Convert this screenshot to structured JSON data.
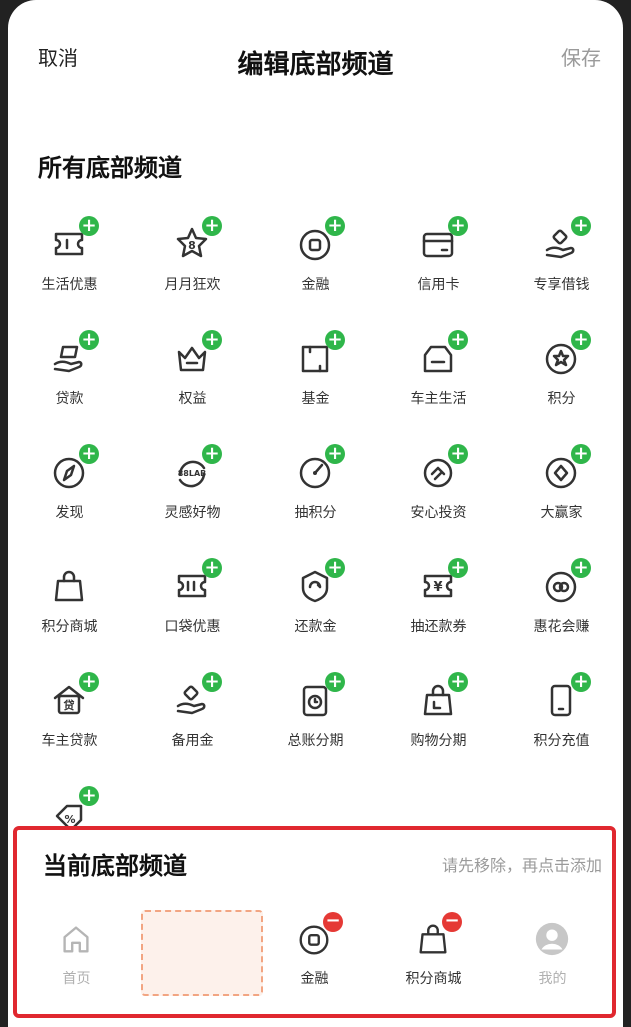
{
  "header": {
    "cancel": "取消",
    "title": "编辑底部频道",
    "save": "保存"
  },
  "all_section": {
    "title": "所有底部频道",
    "items": [
      {
        "label": "生活优惠",
        "icon": "ticket-icon"
      },
      {
        "label": "月月狂欢",
        "icon": "star-badge-icon"
      },
      {
        "label": "金融",
        "icon": "coin-icon"
      },
      {
        "label": "信用卡",
        "icon": "credit-card-icon"
      },
      {
        "label": "专享借钱",
        "icon": "hand-coin-icon"
      },
      {
        "label": "贷款",
        "icon": "hand-money-icon"
      },
      {
        "label": "权益",
        "icon": "crown-icon"
      },
      {
        "label": "基金",
        "icon": "fund-icon"
      },
      {
        "label": "车主生活",
        "icon": "car-icon"
      },
      {
        "label": "积分",
        "icon": "points-star-icon"
      },
      {
        "label": "发现",
        "icon": "compass-icon"
      },
      {
        "label": "灵感好物",
        "icon": "lab-icon"
      },
      {
        "label": "抽积分",
        "icon": "gauge-icon"
      },
      {
        "label": "安心投资",
        "icon": "shield-invest-icon"
      },
      {
        "label": "大赢家",
        "icon": "diamond-circle-icon"
      },
      {
        "label": "积分商城",
        "icon": "shopping-bag-icon"
      },
      {
        "label": "口袋优惠",
        "icon": "pocket-ticket-icon"
      },
      {
        "label": "还款金",
        "icon": "repay-shield-icon"
      },
      {
        "label": "抽还款券",
        "icon": "yuan-ticket-icon"
      },
      {
        "label": "惠花会赚",
        "icon": "flower-circle-icon"
      },
      {
        "label": "车主贷款",
        "icon": "loan-house-icon"
      },
      {
        "label": "备用金",
        "icon": "hand-coin-icon"
      },
      {
        "label": "总账分期",
        "icon": "clock-doc-icon"
      },
      {
        "label": "购物分期",
        "icon": "bag-installment-icon"
      },
      {
        "label": "积分充值",
        "icon": "phone-recharge-icon"
      },
      {
        "label": "",
        "icon": "percent-tag-icon"
      }
    ]
  },
  "current_section": {
    "title": "当前底部频道",
    "hint": "请先移除，再点击添加",
    "tabs": [
      {
        "label": "首页",
        "icon": "home-icon"
      },
      {
        "label": "",
        "icon": "empty-slot"
      },
      {
        "label": "金融",
        "icon": "coin-icon"
      },
      {
        "label": "积分商城",
        "icon": "shopping-bag-icon"
      },
      {
        "label": "我的",
        "icon": "avatar-icon"
      }
    ]
  },
  "colors": {
    "add": "#2fb64a",
    "remove": "#e53935",
    "highlight": "#e0282f"
  }
}
